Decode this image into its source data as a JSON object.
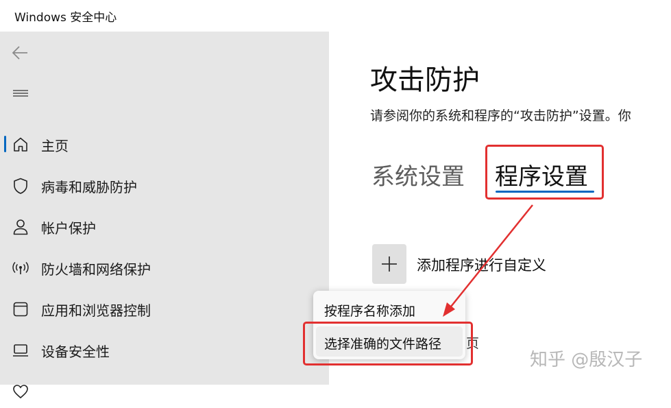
{
  "window": {
    "title": "Windows 安全中心"
  },
  "sidebar": {
    "items": [
      {
        "label": "主页",
        "icon": "home-icon",
        "selected": true
      },
      {
        "label": "病毒和威胁防护",
        "icon": "shield-icon"
      },
      {
        "label": "帐户保护",
        "icon": "person-icon"
      },
      {
        "label": "防火墙和网络保护",
        "icon": "wifi-antenna-icon"
      },
      {
        "label": "应用和浏览器控制",
        "icon": "app-window-icon"
      },
      {
        "label": "设备安全性",
        "icon": "laptop-icon"
      }
    ]
  },
  "main": {
    "title": "攻击防护",
    "description": "请参阅你的系统和程序的“攻击防护”设置。你",
    "tabs": [
      {
        "label": "系统设置",
        "selected": false
      },
      {
        "label": "程序设置",
        "selected": true
      }
    ],
    "add_button_label": "添加程序进行自定义",
    "partial_text": "页"
  },
  "popup": {
    "items": [
      {
        "label": "按程序名称添加"
      },
      {
        "label": "选择准确的文件路径",
        "hovered": true
      }
    ]
  },
  "watermark": "知乎 @殷汉子",
  "colors": {
    "accent": "#0067c0",
    "annotation_red": "#e23030",
    "sidebar_bg": "#e6e6e6"
  }
}
